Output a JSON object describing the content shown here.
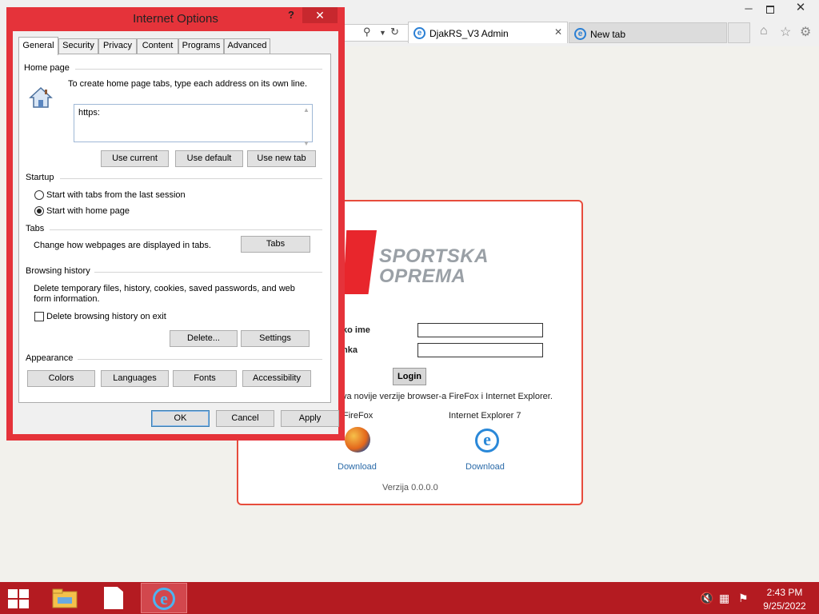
{
  "browser": {
    "caption_min": "─",
    "caption_close": "✕",
    "tabs": [
      {
        "label": "DjakRS_V3 Admin",
        "close": "✕"
      },
      {
        "label": "New tab"
      }
    ],
    "toolbar_icons": [
      "home-icon",
      "favorites-star-icon",
      "settings-gear-icon"
    ]
  },
  "page": {
    "logo_line1": "SPORTSKA",
    "logo_line2": "OPREMA",
    "username_label": "ko ime",
    "password_label": "nka",
    "login_button": "Login",
    "browser_note": "va novije verzije browser-a FireFox i Internet Explorer.",
    "firefox_label": "FireFox",
    "ie_label": "Internet Explorer 7",
    "ie_glyph": "e",
    "download_firefox": "Download",
    "download_ie": "Download",
    "version": "Verzija 0.0.0.0"
  },
  "dialog": {
    "title": "Internet Options",
    "help": "?",
    "close": "✕",
    "tabs": [
      "General",
      "Security",
      "Privacy",
      "Content",
      "Programs",
      "Advanced"
    ],
    "home_page": {
      "title": "Home page",
      "instruction": "To create home page tabs, type each address on its own line.",
      "urls_value": "https:",
      "use_current": "Use current",
      "use_default": "Use default",
      "use_new_tab": "Use new tab"
    },
    "startup": {
      "title": "Startup",
      "option_last_session": "Start with tabs from the last session",
      "option_home_page": "Start with home page",
      "selected": "Start with home page"
    },
    "tabs_group": {
      "title": "Tabs",
      "description": "Change how webpages are displayed in tabs.",
      "button": "Tabs"
    },
    "browsing_history": {
      "title": "Browsing history",
      "description_line1": "Delete temporary files, history, cookies, saved passwords, and web",
      "description_line2": "form information.",
      "delete_on_exit_label": "Delete browsing history on exit",
      "delete_on_exit_checked": false,
      "delete_button": "Delete...",
      "settings_button": "Settings"
    },
    "appearance": {
      "title": "Appearance",
      "colors": "Colors",
      "languages": "Languages",
      "fonts": "Fonts",
      "accessibility": "Accessibility"
    },
    "ok": "OK",
    "cancel": "Cancel",
    "apply": "Apply"
  },
  "taskbar": {
    "time": "2:43 PM",
    "date": "9/25/2022",
    "ie_glyph": "e",
    "pinned": [
      "file-explorer-icon",
      "notepad-icon",
      "internet-explorer-icon"
    ],
    "tray_icons": [
      "speaker-muted-icon",
      "network-icon",
      "action-center-flag-icon"
    ]
  },
  "colors": {
    "accent_red": "#e5333a",
    "taskbar_red": "#b41b21",
    "link_blue": "#2a6aa8"
  }
}
